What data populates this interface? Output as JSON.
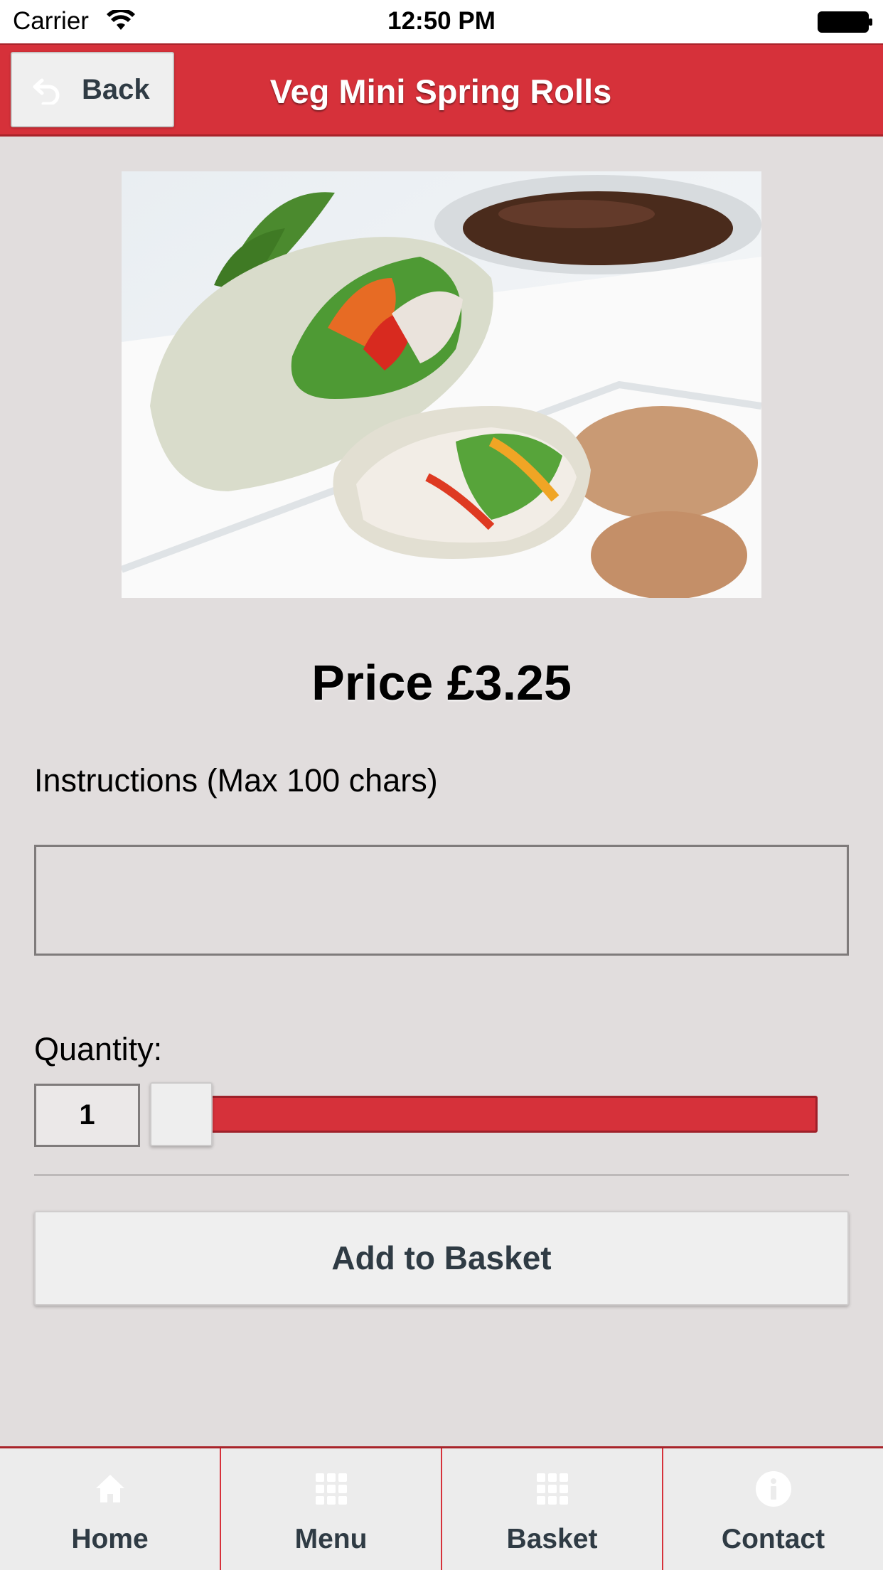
{
  "status_bar": {
    "carrier": "Carrier",
    "time": "12:50 PM",
    "wifi_icon": "wifi-icon",
    "battery_icon": "battery-icon"
  },
  "header": {
    "back_label": "Back",
    "back_icon": "back-arrow-icon",
    "title": "Veg Mini Spring Rolls",
    "color": "#d6313a"
  },
  "product": {
    "price": "Price £3.25"
  },
  "instructions": {
    "label": "Instructions (Max 100 chars)",
    "value": "",
    "placeholder": ""
  },
  "quantity": {
    "label": "Quantity:",
    "value": "1",
    "slider_level": 0
  },
  "actions": {
    "add_label": "Add to Basket"
  },
  "tab_bar": {
    "items": [
      {
        "label": "Home",
        "icon": "home-icon"
      },
      {
        "label": "Menu",
        "icon": "grid-icon"
      },
      {
        "label": "Basket",
        "icon": "grid-icon"
      },
      {
        "label": "Contact",
        "icon": "info-icon"
      }
    ]
  }
}
